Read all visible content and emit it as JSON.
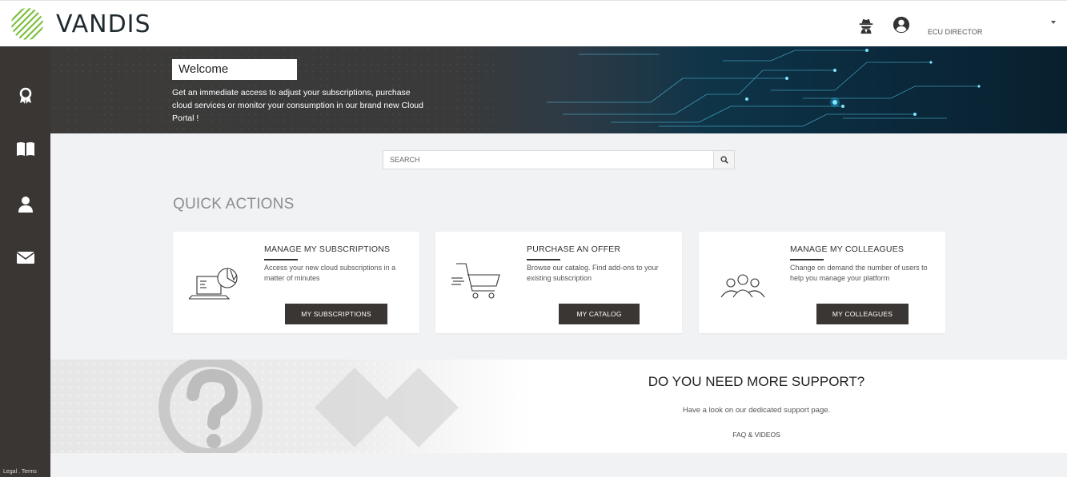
{
  "header": {
    "logo_text": "VANDIS",
    "user_name": "ECU DIRECTOR",
    "icons": [
      "incognito-icon",
      "user-circle-icon",
      "caret-down-icon"
    ]
  },
  "sidebar": {
    "items": [
      {
        "icon": "award-icon"
      },
      {
        "icon": "book-icon"
      },
      {
        "icon": "user-icon"
      },
      {
        "icon": "envelope-icon"
      }
    ],
    "legal_text": "Legal . Terms"
  },
  "banner": {
    "welcome": "Welcome",
    "description": "Get an immediate access to adjust your subscriptions, purchase cloud services or monitor your consumption in our brand new Cloud Portal !"
  },
  "search": {
    "placeholder": "SEARCH"
  },
  "quick_actions": {
    "title": "QUICK ACTIONS",
    "cards": [
      {
        "title": "MANAGE MY SUBSCRIPTIONS",
        "description": "Access your new cloud subscriptions in a matter of minutes",
        "button": "MY SUBSCRIPTIONS"
      },
      {
        "title": "PURCHASE AN OFFER",
        "description": "Browse our catalog. Find add-ons to your existing subscription",
        "button": "MY CATALOG"
      },
      {
        "title": "MANAGE MY COLLEAGUES",
        "description": "Change on demand the number of users to help you manage your platform",
        "button": "MY COLLEAGUES"
      }
    ]
  },
  "support": {
    "title": "DO YOU NEED MORE SUPPORT?",
    "subtitle": "Have a look on our dedicated support page.",
    "link": "FAQ & VIDEOS"
  },
  "colors": {
    "sidebar": "#3a3633",
    "button": "#3a3633",
    "background": "#f1f2f4",
    "banner_accent": "#1ec8ff"
  }
}
